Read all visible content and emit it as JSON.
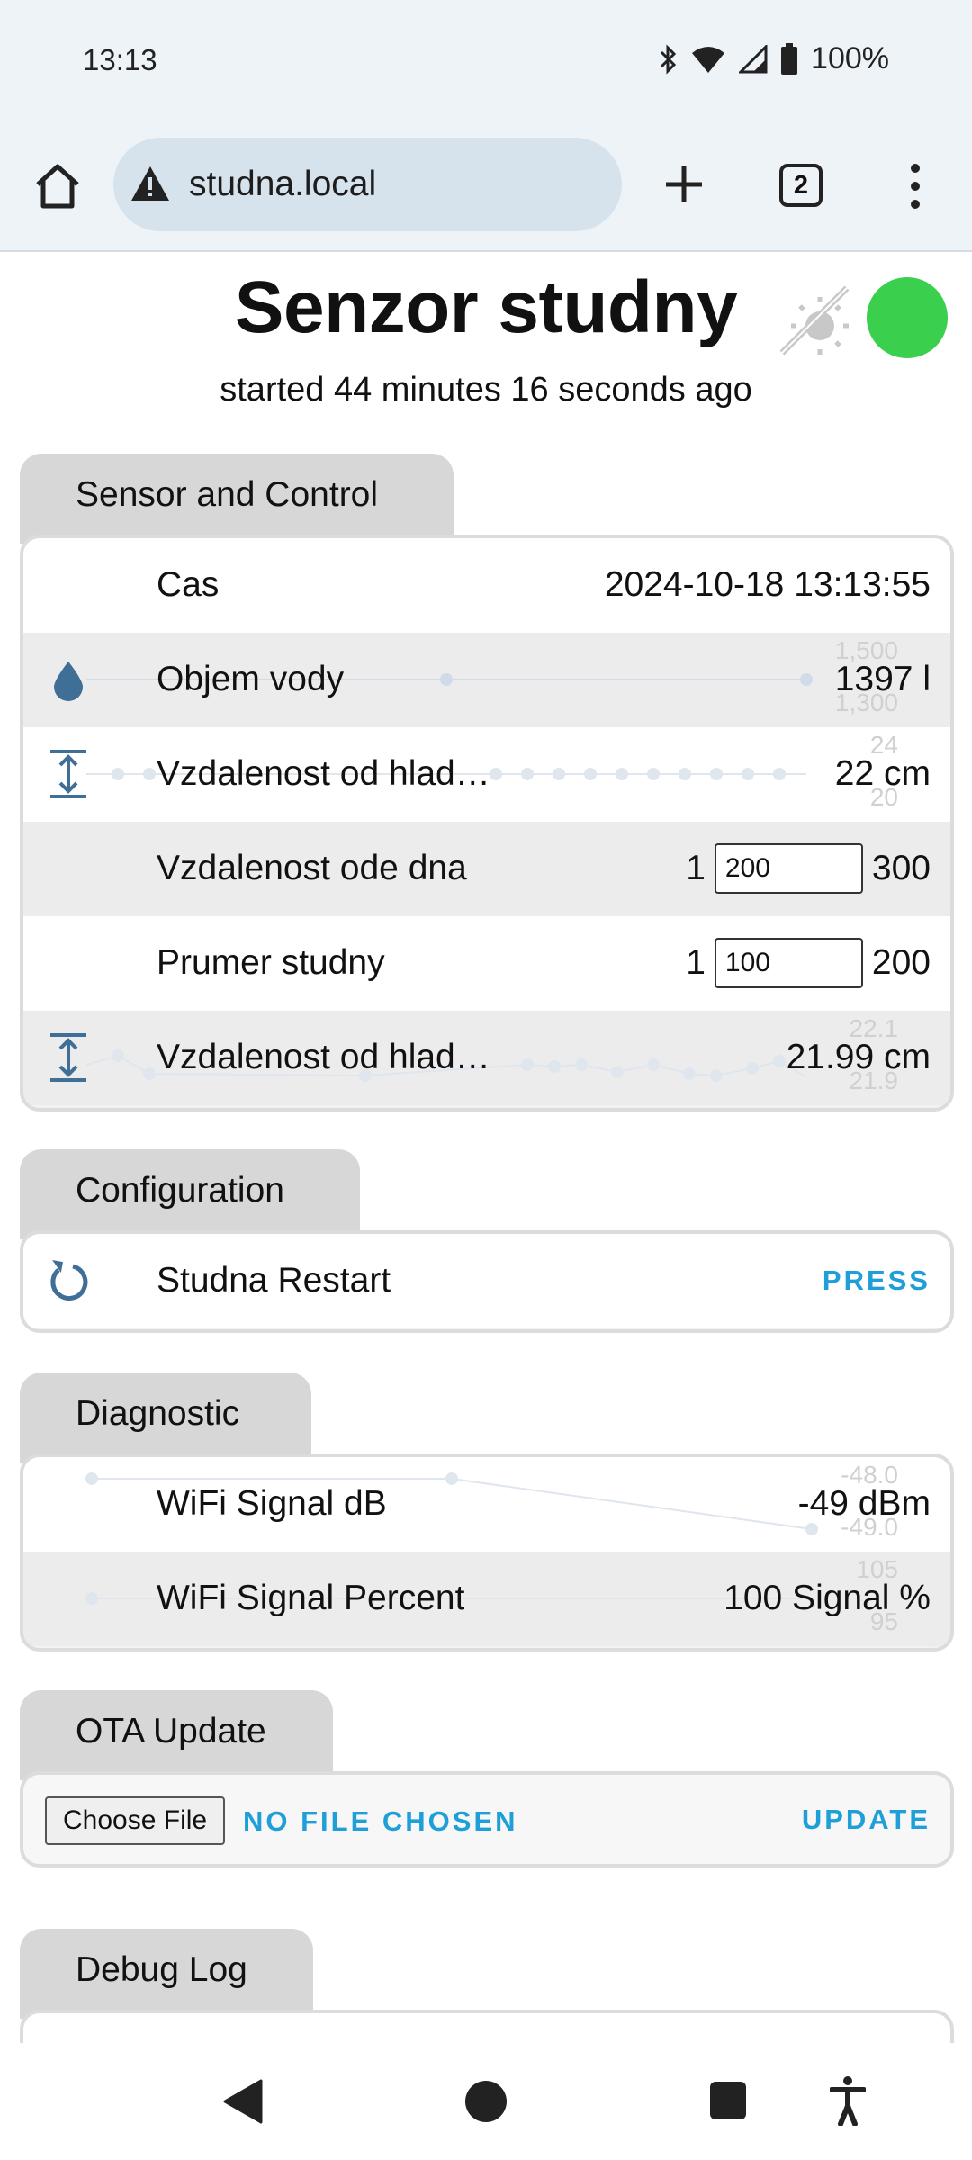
{
  "status_bar": {
    "time": "13:13",
    "battery": "100%"
  },
  "browser": {
    "url": "studna.local",
    "tab_count": "2"
  },
  "header": {
    "title": "Senzor studny",
    "subtitle": "started 44 minutes 16 seconds ago",
    "status_color": "#3ad04d"
  },
  "sensor": {
    "tab": "Sensor and Control",
    "rows": [
      {
        "label": "Cas",
        "value": "2024-10-18 13:13:55"
      },
      {
        "label": "Objem vody",
        "value": "1397 l",
        "spark_high": "1,500",
        "spark_low": "1,300"
      },
      {
        "label": "Vzdalenost od hlad…",
        "value": "22 cm",
        "spark_high": "24",
        "spark_low": "20"
      },
      {
        "label": "Vzdalenost ode dna",
        "min": "1",
        "input": "200",
        "max": "300"
      },
      {
        "label": "Prumer studny",
        "min": "1",
        "input": "100",
        "max": "200"
      },
      {
        "label": "Vzdalenost od hlad…",
        "value": "21.99 cm",
        "spark_high": "22.1",
        "spark_low": "21.9"
      }
    ]
  },
  "config": {
    "tab": "Configuration",
    "rows": [
      {
        "label": "Studna Restart",
        "action": "PRESS"
      }
    ]
  },
  "diagnostic": {
    "tab": "Diagnostic",
    "rows": [
      {
        "label": "WiFi Signal dB",
        "value": "-49 dBm",
        "spark_high": "-48.0",
        "spark_low": "-49.0"
      },
      {
        "label": "WiFi Signal Percent",
        "value": "100 Signal %",
        "spark_high": "105",
        "spark_low": "95"
      }
    ]
  },
  "ota": {
    "tab": "OTA Update",
    "choose_file": "Choose File",
    "no_file": "NO FILE CHOSEN",
    "update": "UPDATE"
  },
  "debug": {
    "tab": "Debug Log"
  },
  "icons": {
    "drop": "water-drop-icon",
    "distance": "arrow-expand-vertical-icon",
    "restart": "restart-icon"
  },
  "colors": {
    "accent": "#1e9fd8",
    "icon": "#3f6e96"
  }
}
